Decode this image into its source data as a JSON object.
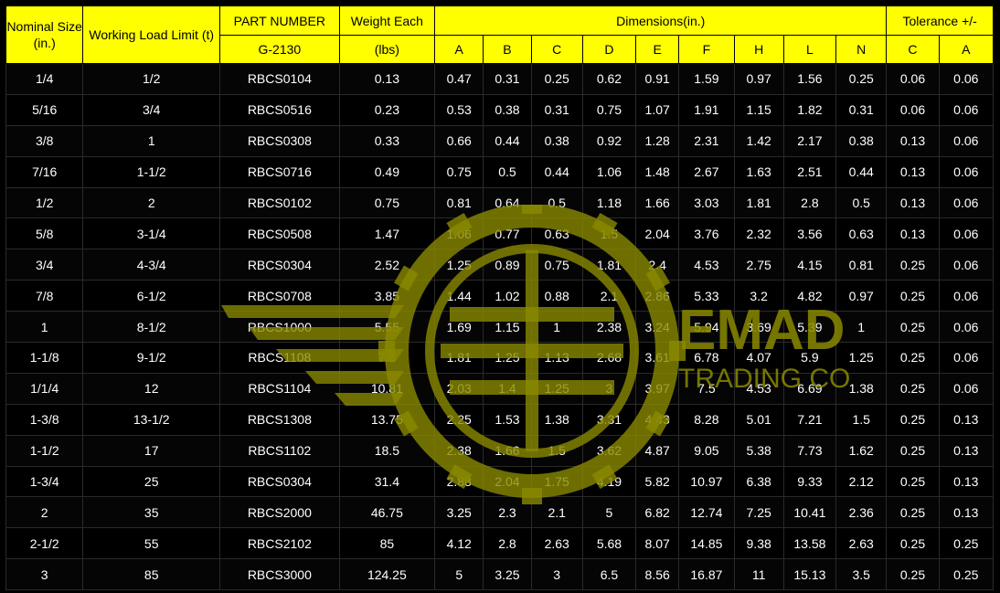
{
  "header": {
    "nominal_size": "Nominal Size (in.)",
    "working_load_limit": "Working Load Limit (t)",
    "part_number": "PART NUMBER",
    "part_sub": "G-2130",
    "weight_each": "Weight Each",
    "weight_sub": "(lbs)",
    "dimensions": "Dimensions(in.)",
    "tolerance": "Tolerance +/-",
    "dim_cols": [
      "A",
      "B",
      "C",
      "D",
      "E",
      "F",
      "H",
      "L",
      "N"
    ],
    "tol_cols": [
      "C",
      "A"
    ]
  },
  "rows": [
    [
      "1/4",
      "1/2",
      "RBCS0104",
      "0.13",
      "0.47",
      "0.31",
      "0.25",
      "0.62",
      "0.91",
      "1.59",
      "0.97",
      "1.56",
      "0.25",
      "0.06",
      "0.06"
    ],
    [
      "5/16",
      "3/4",
      "RBCS0516",
      "0.23",
      "0.53",
      "0.38",
      "0.31",
      "0.75",
      "1.07",
      "1.91",
      "1.15",
      "1.82",
      "0.31",
      "0.06",
      "0.06"
    ],
    [
      "3/8",
      "1",
      "RBCS0308",
      "0.33",
      "0.66",
      "0.44",
      "0.38",
      "0.92",
      "1.28",
      "2.31",
      "1.42",
      "2.17",
      "0.38",
      "0.13",
      "0.06"
    ],
    [
      "7/16",
      "1-1/2",
      "RBCS0716",
      "0.49",
      "0.75",
      "0.5",
      "0.44",
      "1.06",
      "1.48",
      "2.67",
      "1.63",
      "2.51",
      "0.44",
      "0.13",
      "0.06"
    ],
    [
      "1/2",
      "2",
      "RBCS0102",
      "0.75",
      "0.81",
      "0.64",
      "0.5",
      "1.18",
      "1.66",
      "3.03",
      "1.81",
      "2.8",
      "0.5",
      "0.13",
      "0.06"
    ],
    [
      "5/8",
      "3-1/4",
      "RBCS0508",
      "1.47",
      "1.06",
      "0.77",
      "0.63",
      "1.5",
      "2.04",
      "3.76",
      "2.32",
      "3.56",
      "0.63",
      "0.13",
      "0.06"
    ],
    [
      "3/4",
      "4-3/4",
      "RBCS0304",
      "2.52",
      "1.25",
      "0.89",
      "0.75",
      "1.81",
      "2.4",
      "4.53",
      "2.75",
      "4.15",
      "0.81",
      "0.25",
      "0.06"
    ],
    [
      "7/8",
      "6-1/2",
      "RBCS0708",
      "3.85",
      "1.44",
      "1.02",
      "0.88",
      "2.1",
      "2.86",
      "5.33",
      "3.2",
      "4.82",
      "0.97",
      "0.25",
      "0.06"
    ],
    [
      "1",
      "8-1/2",
      "RBCS1000",
      "5.55",
      "1.69",
      "1.15",
      "1",
      "2.38",
      "3.24",
      "5.94",
      "3.69",
      "5.39",
      "1",
      "0.25",
      "0.06"
    ],
    [
      "1-1/8",
      "9-1/2",
      "RBCS1108",
      "7.6",
      "1.81",
      "1.25",
      "1.13",
      "2.68",
      "3.61",
      "6.78",
      "4.07",
      "5.9",
      "1.25",
      "0.25",
      "0.06"
    ],
    [
      "1/1/4",
      "12",
      "RBCS1104",
      "10.81",
      "2.03",
      "1.4",
      "1.25",
      "3",
      "3.97",
      "7.5",
      "4.53",
      "6.69",
      "1.38",
      "0.25",
      "0.06"
    ],
    [
      "1-3/8",
      "13-1/2",
      "RBCS1308",
      "13.75",
      "2.25",
      "1.53",
      "1.38",
      "3.31",
      "4.43",
      "8.28",
      "5.01",
      "7.21",
      "1.5",
      "0.25",
      "0.13"
    ],
    [
      "1-1/2",
      "17",
      "RBCS1102",
      "18.5",
      "2.38",
      "1.66",
      "1.5",
      "3.62",
      "4.87",
      "9.05",
      "5.38",
      "7.73",
      "1.62",
      "0.25",
      "0.13"
    ],
    [
      "1-3/4",
      "25",
      "RBCS0304",
      "31.4",
      "2.88",
      "2.04",
      "1.75",
      "4.19",
      "5.82",
      "10.97",
      "6.38",
      "9.33",
      "2.12",
      "0.25",
      "0.13"
    ],
    [
      "2",
      "35",
      "RBCS2000",
      "46.75",
      "3.25",
      "2.3",
      "2.1",
      "5",
      "6.82",
      "12.74",
      "7.25",
      "10.41",
      "2.36",
      "0.25",
      "0.13"
    ],
    [
      "2-1/2",
      "55",
      "RBCS2102",
      "85",
      "4.12",
      "2.8",
      "2.63",
      "5.68",
      "8.07",
      "14.85",
      "9.38",
      "13.58",
      "2.63",
      "0.25",
      "0.25"
    ],
    [
      "3",
      "85",
      "RBCS3000",
      "124.25",
      "5",
      "3.25",
      "3",
      "6.5",
      "8.56",
      "16.87",
      "11",
      "15.13",
      "3.5",
      "0.25",
      "0.25"
    ]
  ],
  "watermark": {
    "brand": "EMAD",
    "tagline": "TRADING CO",
    "color": "#8a8a00"
  },
  "colors": {
    "header_bg": "#ffff00",
    "body_bg": "#000000",
    "body_text": "#ffffff"
  }
}
